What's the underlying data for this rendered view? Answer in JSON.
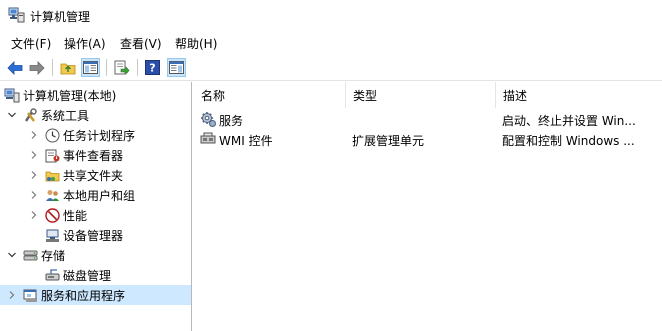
{
  "window": {
    "title": "计算机管理"
  },
  "menu": [
    "文件(F)",
    "操作(A)",
    "查看(V)",
    "帮助(H)"
  ],
  "toolbar": {
    "buttons": [
      "back",
      "forward",
      "up-folder",
      "show-hide-tree",
      "export-list",
      "help",
      "show-hide-action-pane"
    ]
  },
  "tree": {
    "root": "计算机管理(本地)",
    "items": [
      {
        "label": "系统工具"
      },
      {
        "label": "任务计划程序"
      },
      {
        "label": "事件查看器"
      },
      {
        "label": "共享文件夹"
      },
      {
        "label": "本地用户和组"
      },
      {
        "label": "性能"
      },
      {
        "label": "设备管理器"
      },
      {
        "label": "存储"
      },
      {
        "label": "磁盘管理"
      },
      {
        "label": "服务和应用程序"
      }
    ]
  },
  "list": {
    "columns": [
      "名称",
      "类型",
      "描述"
    ],
    "rows": [
      {
        "name": "服务",
        "type": "",
        "desc": "启动、终止并设置 Win..."
      },
      {
        "name": "WMI 控件",
        "type": "扩展管理单元",
        "desc": "配置和控制 Windows ..."
      }
    ]
  },
  "colors": {
    "selection": "#cde8ff",
    "pressed": "#cce4f7",
    "accent": "#2b6fd6"
  }
}
